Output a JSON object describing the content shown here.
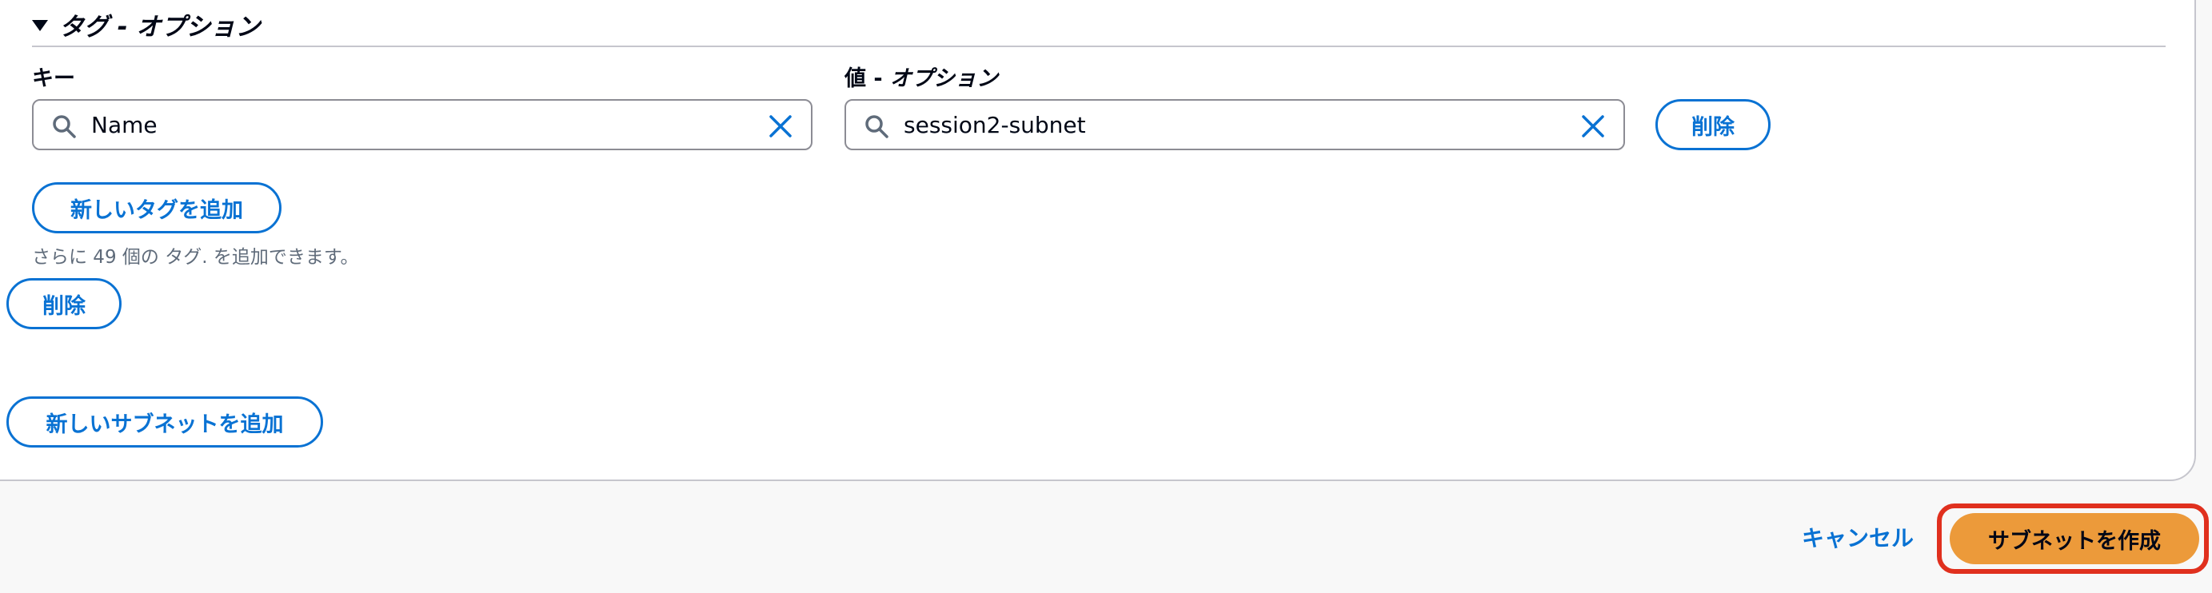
{
  "tags_section": {
    "title": "タグ - オプション",
    "key_label": "キー",
    "value_label_prefix": "値 - ",
    "value_label_suffix": "オプション",
    "key_value": "Name",
    "value_value": "session2-subnet",
    "remove_tag_label": "削除",
    "add_tag_label": "新しいタグを追加",
    "helper_text": "さらに 49 個の タグ. を追加できます。"
  },
  "subnet": {
    "remove_label": "削除",
    "add_subnet_label": "新しいサブネットを追加"
  },
  "footer": {
    "cancel_label": "キャンセル",
    "create_label": "サブネットを作成"
  },
  "icons": {
    "expand": "caret-down-icon",
    "search": "search-icon",
    "clear": "clear-icon"
  },
  "colors": {
    "link_blue": "#0972d3",
    "primary_orange": "#ec9a3a",
    "highlight_red": "#e0301e"
  }
}
